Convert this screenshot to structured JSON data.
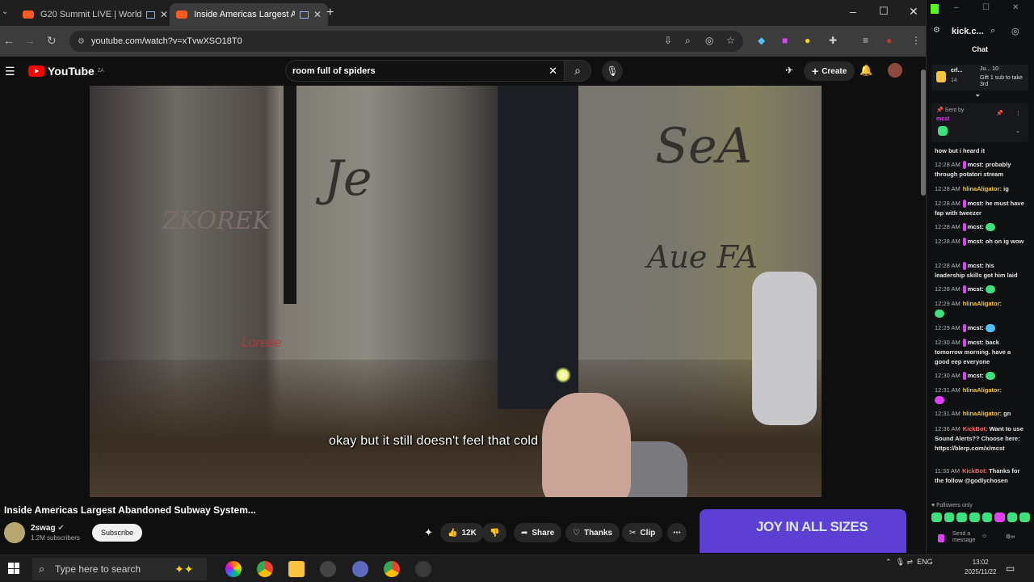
{
  "browser": {
    "tabs": [
      {
        "title": "G20 Summit LIVE | World Le",
        "active": false
      },
      {
        "title": "Inside Americas Largest Ab",
        "active": true
      }
    ],
    "url": "youtube.com/watch?v=xTvwXSO18T0",
    "new_tab": "+",
    "window_controls": {
      "min": "–",
      "max": "☐",
      "close": "✕"
    }
  },
  "youtube": {
    "logo": "YouTube",
    "country": "ZA",
    "search_query": "room full of spiders",
    "create_label": "Create",
    "video": {
      "caption": "okay but it still doesn't feel that cold",
      "title": "Inside Americas Largest Abandoned Subway System...",
      "channel": "2swag",
      "subscribers": "1.2M subscribers",
      "subscribe_label": "Subscribe",
      "likes": "12K",
      "share_label": "Share",
      "thanks_label": "Thanks",
      "clip_label": "Clip"
    },
    "ad_text": "JOY IN ALL SIZES"
  },
  "kick": {
    "title": "kick.c...",
    "chat_label": "Chat",
    "pinned": {
      "user": "crl...",
      "info": "Ju... 10",
      "count": "14",
      "text": "Gift 1 sub to take 3rd"
    },
    "sent_by": {
      "label": "Sent by",
      "user": "mcst"
    },
    "messages": [
      {
        "time": "",
        "user": "",
        "text": "how but i heard it"
      },
      {
        "time": "12:28 AM",
        "user": "mcst:",
        "text": "probably through potatori stream"
      },
      {
        "time": "12:28 AM",
        "user": "hlinaAligator:",
        "text": "ig"
      },
      {
        "time": "12:28 AM",
        "user": "mcst:",
        "text": "he must have fap with tweezer"
      },
      {
        "time": "12:28 AM",
        "user": "mcst:",
        "text": ""
      },
      {
        "time": "12:28 AM",
        "user": "mcst:",
        "text": "oh on ig wow"
      },
      {
        "time": "12:28 AM",
        "user": "mcst:",
        "text": "his leadership skills got him laid"
      },
      {
        "time": "12:28 AM",
        "user": "mcst:",
        "text": ""
      },
      {
        "time": "12:29 AM",
        "user": "hlinaAligator:",
        "text": ""
      },
      {
        "time": "12:29 AM",
        "user": "mcst:",
        "text": ""
      },
      {
        "time": "12:30 AM",
        "user": "mcst:",
        "text": "back tomorrow morning. have a good eep everyone"
      },
      {
        "time": "12:30 AM",
        "user": "mcst:",
        "text": ""
      },
      {
        "time": "12:31 AM",
        "user": "hlinaAligator:",
        "text": ""
      },
      {
        "time": "12:31 AM",
        "user": "hlinaAligator:",
        "text": "gn"
      },
      {
        "time": "12:36 AM",
        "user": "KickBot:",
        "text": "Want to use Sound Alerts?? Choose here: https://blerp.com/x/mcst"
      },
      {
        "time": "11:33 AM",
        "user": "KickBot:",
        "text": "Thanks for the follow @godlychosen"
      }
    ],
    "followers_only": "Followers only",
    "send_placeholder": "Send a message"
  },
  "taskbar": {
    "search_placeholder": "Type here to search",
    "lang": "ENG",
    "time": "13:02",
    "date": "2025/11/22"
  }
}
